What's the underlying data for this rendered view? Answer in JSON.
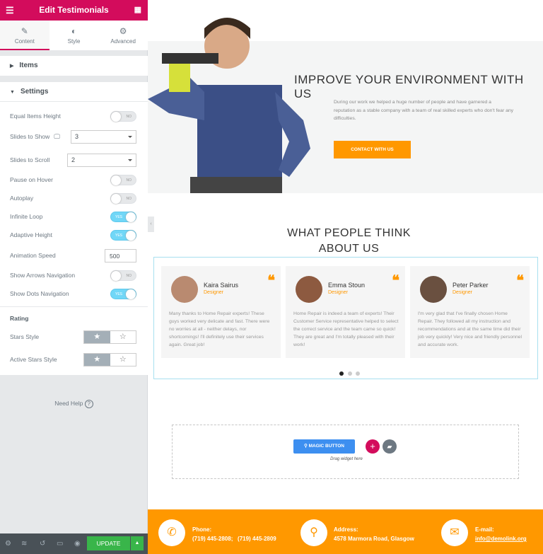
{
  "panel": {
    "title": "Edit Testimonials",
    "tabs": [
      {
        "label": "Content",
        "icon": "pencil-icon"
      },
      {
        "label": "Style",
        "icon": "contrast-icon"
      },
      {
        "label": "Advanced",
        "icon": "gear-icon"
      }
    ],
    "sections": {
      "items": "Items",
      "settings": "Settings"
    },
    "settings": {
      "equal_items_height": {
        "label": "Equal Items Height",
        "value": "NO"
      },
      "slides_to_show": {
        "label": "Slides to Show",
        "value": "3"
      },
      "slides_to_scroll": {
        "label": "Slides to Scroll",
        "value": "2"
      },
      "pause_on_hover": {
        "label": "Pause on Hover",
        "value": "NO"
      },
      "autoplay": {
        "label": "Autoplay",
        "value": "NO"
      },
      "infinite_loop": {
        "label": "Infinite Loop",
        "value": "YES"
      },
      "adaptive_height": {
        "label": "Adaptive Height",
        "value": "YES"
      },
      "animation_speed": {
        "label": "Animation Speed",
        "value": "500"
      },
      "show_arrows": {
        "label": "Show Arrows Navigation",
        "value": "NO"
      },
      "show_dots": {
        "label": "Show Dots Navigation",
        "value": "YES"
      }
    },
    "rating": {
      "heading": "Rating",
      "stars_style": "Stars Style",
      "active_stars_style": "Active Stars Style"
    },
    "need_help": "Need Help",
    "update": "UPDATE"
  },
  "hero": {
    "title": "IMPROVE YOUR ENVIRONMENT WITH US",
    "text": "During our work we helped a huge number of people and have garnered a reputation as a stable company with a team of real skilled experts who don't fear any difficulties.",
    "button": "CONTACT WITH US"
  },
  "testimonials": {
    "title_line1": "WHAT PEOPLE THINK",
    "title_line2": "ABOUT US",
    "items": [
      {
        "name": "Kaira Sairus",
        "role": "Designer",
        "text": "Many thanks to Home Repair experts! These guys worked very delicate and fast. There were no worries at all - neither delays, nor shortcomings! I'll definitely use their services again. Great job!"
      },
      {
        "name": "Emma Stoun",
        "role": "Designer",
        "text": "Home Repair is indeed a team of experts! Their Customer Service representative helped to select the correct service and the team came so quick! They are great and I'm totally pleased with their work!"
      },
      {
        "name": "Peter Parker",
        "role": "Designer",
        "text": "I'm very glad that I've finally chosen Home Repair. They followed all my instruction and recommendations and at the same time did their job very quickly! Very nice and friendly personnel and accurate work."
      }
    ],
    "active_dot": 1,
    "dot_count": 3
  },
  "dropzone": {
    "magic_button": "MAGIC BUTTON",
    "hint": "Drag widget here"
  },
  "footer": {
    "phone_label": "Phone:",
    "phone_value": "(719) 445-2808;   (719) 445-2809",
    "address_label": "Address:",
    "address_value": "4578 Marmora Road, Glasgow",
    "email_label": "E-mail:",
    "email_value": "info@demolink.org"
  },
  "colors": {
    "brand": "#d30c5c",
    "accent": "#ff9800",
    "update": "#39b54a",
    "magic": "#3d8ff0"
  }
}
